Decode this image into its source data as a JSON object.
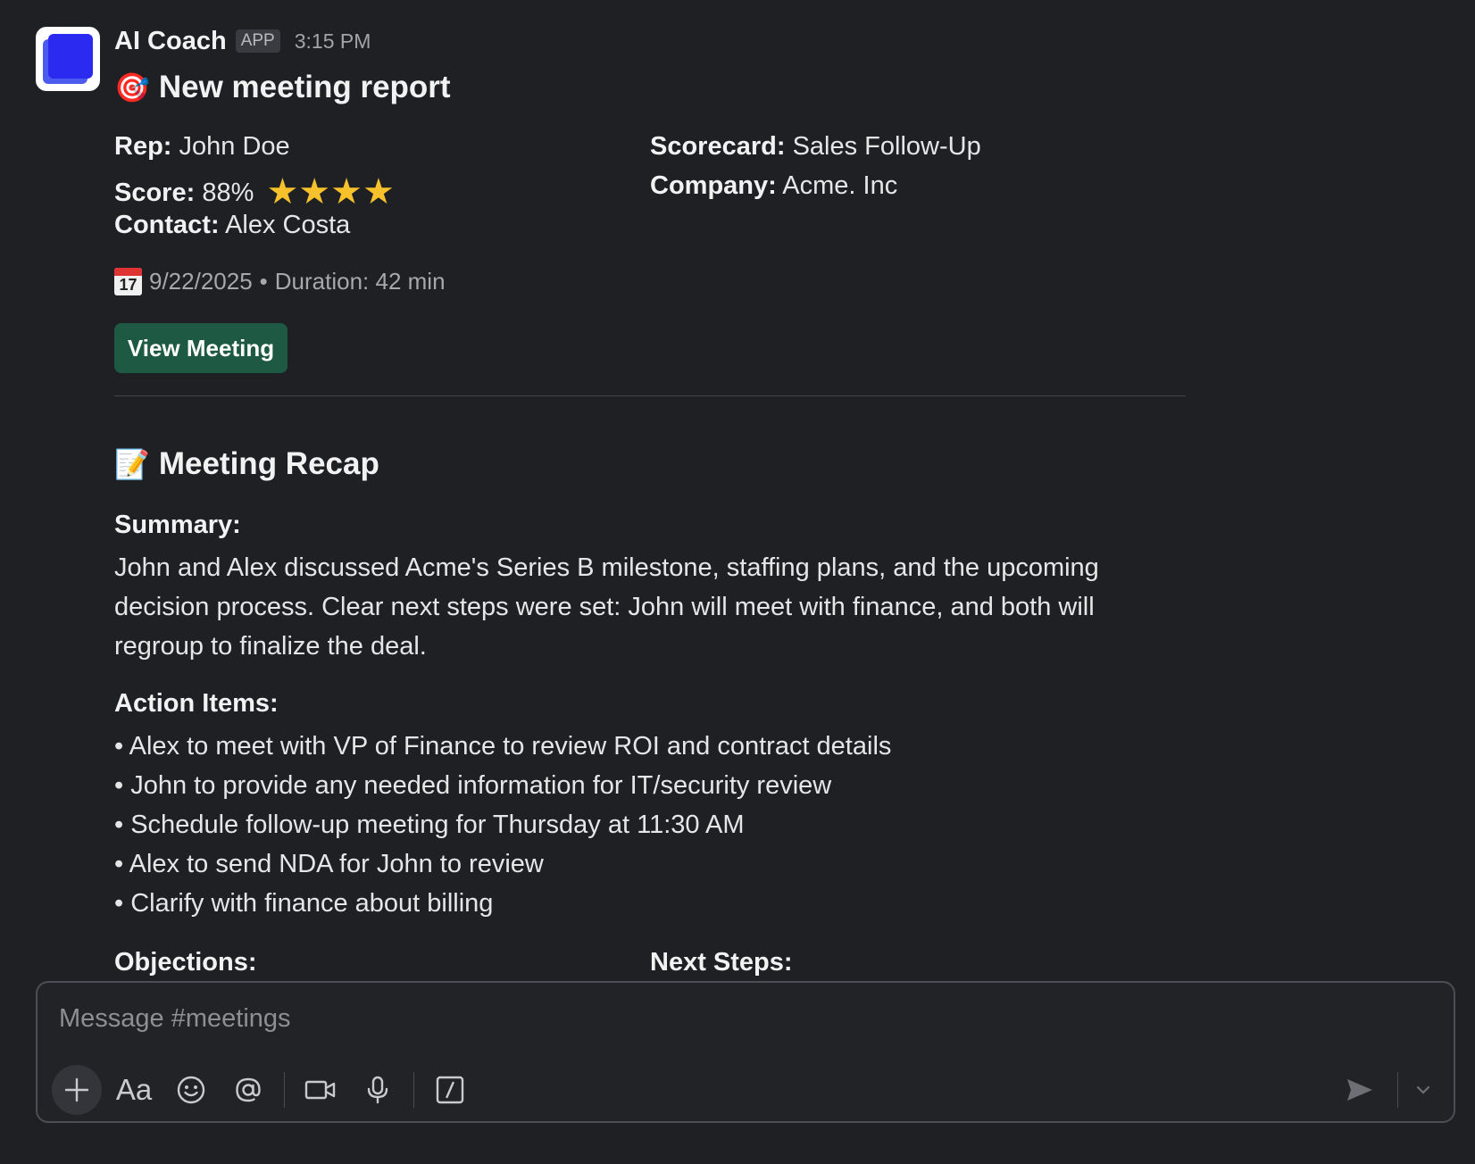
{
  "app": {
    "name": "AI Coach",
    "badge": "APP",
    "timestamp": "3:15 PM"
  },
  "report": {
    "title_emoji": "🎯",
    "title": "New meeting report",
    "rep_label": "Rep:",
    "rep_value": "John Doe",
    "score_label": "Score:",
    "score_value": "88%",
    "score_stars": 4,
    "contact_label": "Contact:",
    "contact_value": "Alex Costa",
    "scorecard_label": "Scorecard:",
    "scorecard_value": "Sales Follow-Up",
    "company_label": "Company:",
    "company_value": "Acme. Inc",
    "date": "9/22/2025",
    "duration": "Duration: 42 min",
    "view_button": "View Meeting"
  },
  "recap": {
    "title_emoji": "📝",
    "title": "Meeting Recap",
    "summary_label": "Summary:",
    "summary_text": "John and Alex discussed Acme's Series B milestone, staffing plans, and the upcoming decision process. Clear next steps were set: John will meet with finance, and both will regroup to finalize the deal.",
    "action_items_label": "Action Items:",
    "action_items": [
      "Alex to meet with VP of Finance to review ROI and contract details",
      "John to provide any needed information for IT/security review",
      "Schedule follow-up meeting for Thursday at 11:30 AM",
      "Alex to send NDA for John to review",
      "Clarify with finance about billing"
    ],
    "objections_label": "Objections:",
    "next_steps_label": "Next Steps:"
  },
  "composer": {
    "placeholder": "Message #meetings",
    "format_label": "Aa"
  },
  "colors": {
    "background": "#1f2024",
    "view_button": "#1e5a43",
    "star": "#f6c12b",
    "avatar_accent": "#2a2af0"
  }
}
